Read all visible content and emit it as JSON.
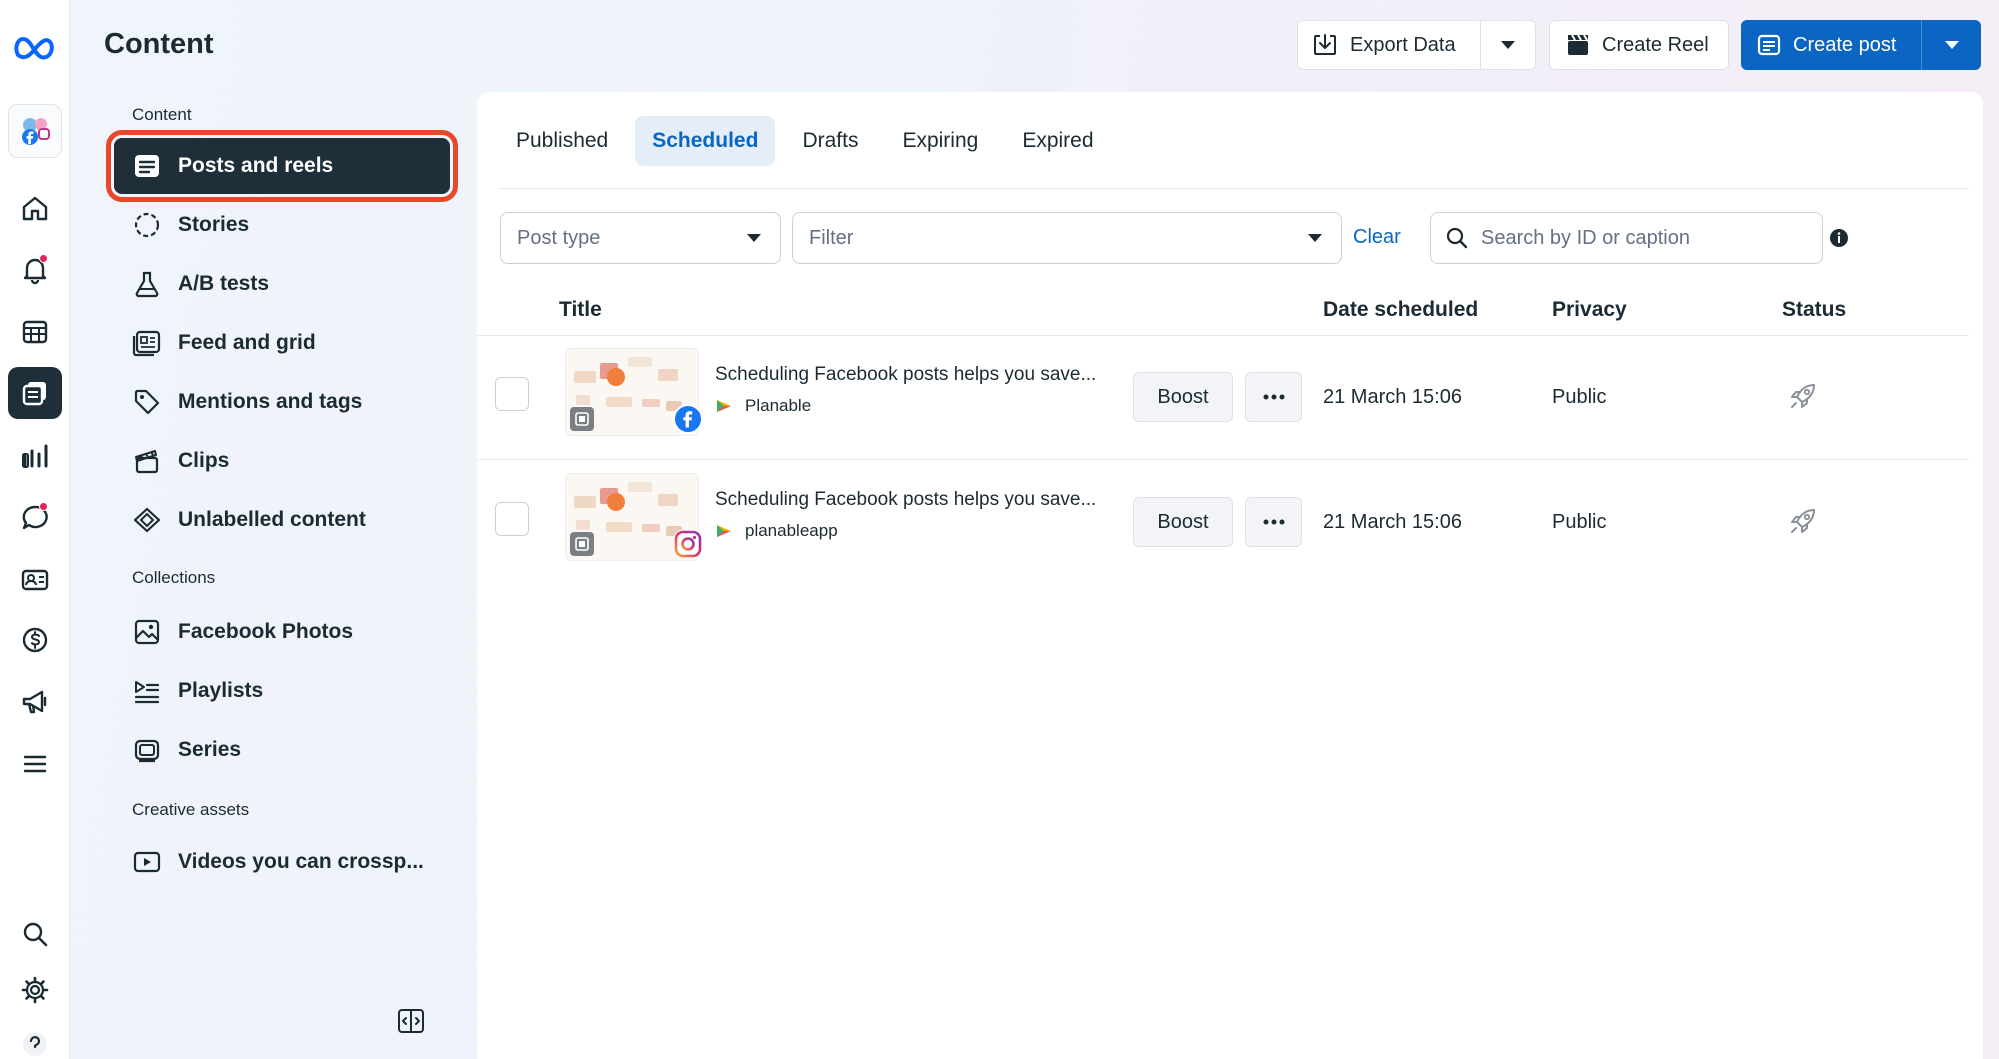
{
  "page": {
    "title": "Content"
  },
  "header": {
    "export_label": "Export Data",
    "create_reel_label": "Create Reel",
    "create_post_label": "Create post",
    "accent_color": "#0a66c2"
  },
  "sidebar": {
    "sections": {
      "content": "Content",
      "collections": "Collections",
      "creative_assets": "Creative assets"
    },
    "items": [
      {
        "label": "Posts and reels",
        "icon": "posts-icon",
        "active": true
      },
      {
        "label": "Stories",
        "icon": "stories-icon"
      },
      {
        "label": "A/B tests",
        "icon": "flask-icon"
      },
      {
        "label": "Feed and grid",
        "icon": "feed-icon"
      },
      {
        "label": "Mentions and tags",
        "icon": "tag-icon"
      },
      {
        "label": "Clips",
        "icon": "clapper-icon"
      },
      {
        "label": "Unlabelled content",
        "icon": "unlabelled-icon"
      }
    ],
    "collections": [
      {
        "label": "Facebook Photos",
        "icon": "photo-icon"
      },
      {
        "label": "Playlists",
        "icon": "playlist-icon"
      },
      {
        "label": "Series",
        "icon": "series-icon"
      }
    ],
    "creative": [
      {
        "label": "Videos you can crossp...",
        "icon": "video-icon"
      }
    ]
  },
  "tabs": [
    {
      "label": "Published"
    },
    {
      "label": "Scheduled",
      "active": true
    },
    {
      "label": "Drafts"
    },
    {
      "label": "Expiring"
    },
    {
      "label": "Expired"
    }
  ],
  "filters": {
    "post_type_placeholder": "Post type",
    "filter_placeholder": "Filter",
    "clear_label": "Clear",
    "search_placeholder": "Search by ID or caption"
  },
  "table": {
    "columns": {
      "title": "Title",
      "date": "Date scheduled",
      "privacy": "Privacy",
      "status": "Status"
    },
    "rows": [
      {
        "title": "Scheduling Facebook posts helps you save...",
        "source": "Planable",
        "network": "facebook",
        "boost_label": "Boost",
        "date": "21 March 15:06",
        "privacy": "Public"
      },
      {
        "title": "Scheduling Facebook posts helps you save...",
        "source": "planableapp",
        "network": "instagram",
        "boost_label": "Boost",
        "date": "21 March 15:06",
        "privacy": "Public"
      }
    ]
  }
}
